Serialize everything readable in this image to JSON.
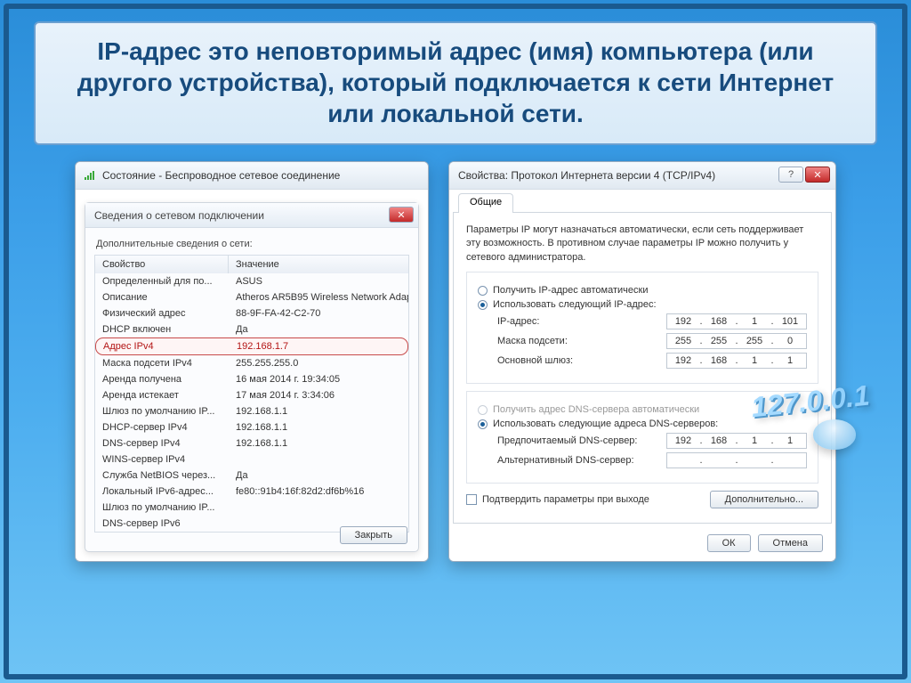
{
  "title": "IP-адрес это неповторимый адрес (имя) компьютера (или другого устройства), который подключается к сети Интернет или локальной сети.",
  "win1": {
    "title": "Состояние - Беспроводное сетевое соединение",
    "inner_title": "Сведения о сетевом подключении",
    "info_head": "Дополнительные сведения о сети:",
    "col1": "Свойство",
    "col2": "Значение",
    "rows": [
      {
        "k": "Определенный для по...",
        "v": "ASUS"
      },
      {
        "k": "Описание",
        "v": "Atheros AR5B95 Wireless Network Adapt"
      },
      {
        "k": "Физический адрес",
        "v": "88-9F-FA-42-C2-70"
      },
      {
        "k": "DHCP включен",
        "v": "Да"
      },
      {
        "k": "Адрес IPv4",
        "v": "192.168.1.7",
        "hl": true
      },
      {
        "k": "Маска подсети IPv4",
        "v": "255.255.255.0"
      },
      {
        "k": "Аренда получена",
        "v": "16 мая 2014 г. 19:34:05"
      },
      {
        "k": "Аренда истекает",
        "v": "17 мая 2014 г. 3:34:06"
      },
      {
        "k": "Шлюз по умолчанию IP...",
        "v": "192.168.1.1"
      },
      {
        "k": "DHCP-сервер IPv4",
        "v": "192.168.1.1"
      },
      {
        "k": "DNS-сервер IPv4",
        "v": "192.168.1.1"
      },
      {
        "k": "WINS-сервер IPv4",
        "v": ""
      },
      {
        "k": "Служба NetBIOS через...",
        "v": "Да"
      },
      {
        "k": "Локальный IPv6-адрес...",
        "v": "fe80::91b4:16f:82d2:df6b%16"
      },
      {
        "k": "Шлюз по умолчанию IP...",
        "v": ""
      },
      {
        "k": "DNS-сервер IPv6",
        "v": ""
      }
    ],
    "close_btn": "Закрыть"
  },
  "win2": {
    "title": "Свойства: Протокол Интернета версии 4 (TCP/IPv4)",
    "tab": "Общие",
    "note": "Параметры IP могут назначаться автоматически, если сеть поддерживает эту возможность. В противном случае параметры IP можно получить у сетевого администратора.",
    "r1": "Получить IP-адрес автоматически",
    "r2": "Использовать следующий IP-адрес:",
    "f1": "IP-адрес:",
    "f2": "Маска подсети:",
    "f3": "Основной шлюз:",
    "ip": [
      "192",
      "168",
      "1",
      "101"
    ],
    "mask": [
      "255",
      "255",
      "255",
      "0"
    ],
    "gw": [
      "192",
      "168",
      "1",
      "1"
    ],
    "r3": "Получить адрес DNS-сервера автоматически",
    "r4": "Использовать следующие адреса DNS-серверов:",
    "f4": "Предпочитаемый DNS-сервер:",
    "f5": "Альтернативный DNS-сервер:",
    "dns1": [
      "192",
      "168",
      "1",
      "1"
    ],
    "dns2": [
      "",
      "",
      "",
      ""
    ],
    "chk": "Подтвердить параметры при выходе",
    "adv": "Дополнительно...",
    "ok": "ОК",
    "cancel": "Отмена"
  },
  "deco": "127.0.0.1"
}
